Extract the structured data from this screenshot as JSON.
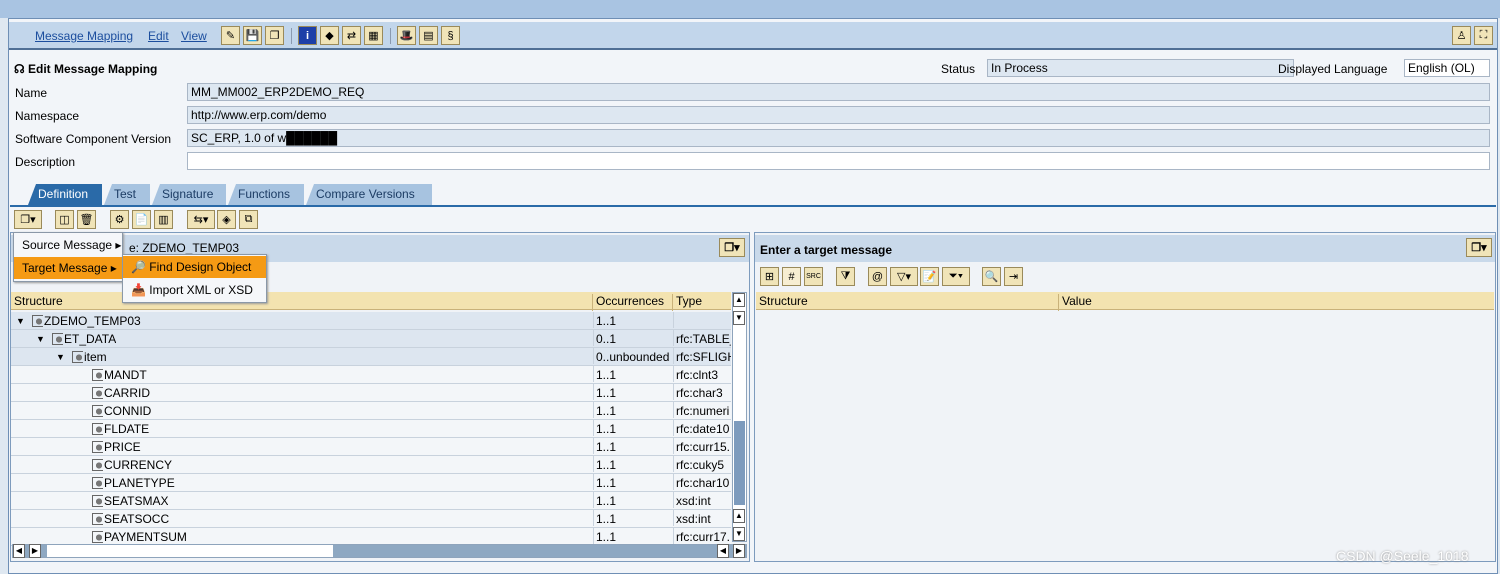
{
  "menu": {
    "items": [
      "Message Mapping",
      "Edit",
      "View"
    ]
  },
  "header": {
    "title": "Edit Message Mapping",
    "status_label": "Status",
    "status_value": "In Process",
    "language_label": "Displayed Language",
    "language_value": "English (OL)"
  },
  "form": [
    {
      "label": "Name",
      "value": "MM_MM002_ERP2DEMO_REQ"
    },
    {
      "label": "Namespace",
      "value": "http://www.erp.com/demo"
    },
    {
      "label": "Software Component Version",
      "value": "SC_ERP, 1.0 of w██████"
    },
    {
      "label": "Description",
      "value": ""
    }
  ],
  "tabs": [
    {
      "label": "Definition",
      "active": true
    },
    {
      "label": "Test"
    },
    {
      "label": "Signature"
    },
    {
      "label": "Functions"
    },
    {
      "label": "Compare Versions"
    }
  ],
  "source_panel": {
    "title_fragment": "e: ZDEMO_TEMP03",
    "columns": [
      "Structure",
      "Occurrences",
      "Type"
    ],
    "rows": [
      {
        "name": "ZDEMO_TEMP03",
        "occ": "1..1",
        "type": "",
        "level": 0,
        "expanded": true
      },
      {
        "name": "ET_DATA",
        "occ": "0..1",
        "type": "rfc:TABLE_",
        "level": 1,
        "expanded": true
      },
      {
        "name": "item",
        "occ": "0..unbounded",
        "type": "rfc:SFLIGH",
        "level": 2,
        "expanded": true
      },
      {
        "name": "MANDT",
        "occ": "1..1",
        "type": "rfc:clnt3",
        "level": 3
      },
      {
        "name": "CARRID",
        "occ": "1..1",
        "type": "rfc:char3",
        "level": 3
      },
      {
        "name": "CONNID",
        "occ": "1..1",
        "type": "rfc:numeri",
        "level": 3
      },
      {
        "name": "FLDATE",
        "occ": "1..1",
        "type": "rfc:date10",
        "level": 3
      },
      {
        "name": "PRICE",
        "occ": "1..1",
        "type": "rfc:curr15.:",
        "level": 3
      },
      {
        "name": "CURRENCY",
        "occ": "1..1",
        "type": "rfc:cuky5",
        "level": 3
      },
      {
        "name": "PLANETYPE",
        "occ": "1..1",
        "type": "rfc:char10",
        "level": 3
      },
      {
        "name": "SEATSMAX",
        "occ": "1..1",
        "type": "xsd:int",
        "level": 3
      },
      {
        "name": "SEATSOCC",
        "occ": "1..1",
        "type": "xsd:int",
        "level": 3
      },
      {
        "name": "PAYMENTSUM",
        "occ": "1..1",
        "type": "rfc:curr17.:",
        "level": 3
      }
    ]
  },
  "target_panel": {
    "title": "Enter a target message",
    "columns": [
      "Structure",
      "Value"
    ]
  },
  "context_menu": {
    "items": [
      "Source Message",
      "Target Message"
    ],
    "submenu": [
      "Find Design Object",
      "Import XML or XSD"
    ],
    "highlight_color": "#f59a14"
  },
  "watermark": "CSDN @Seele_1018"
}
